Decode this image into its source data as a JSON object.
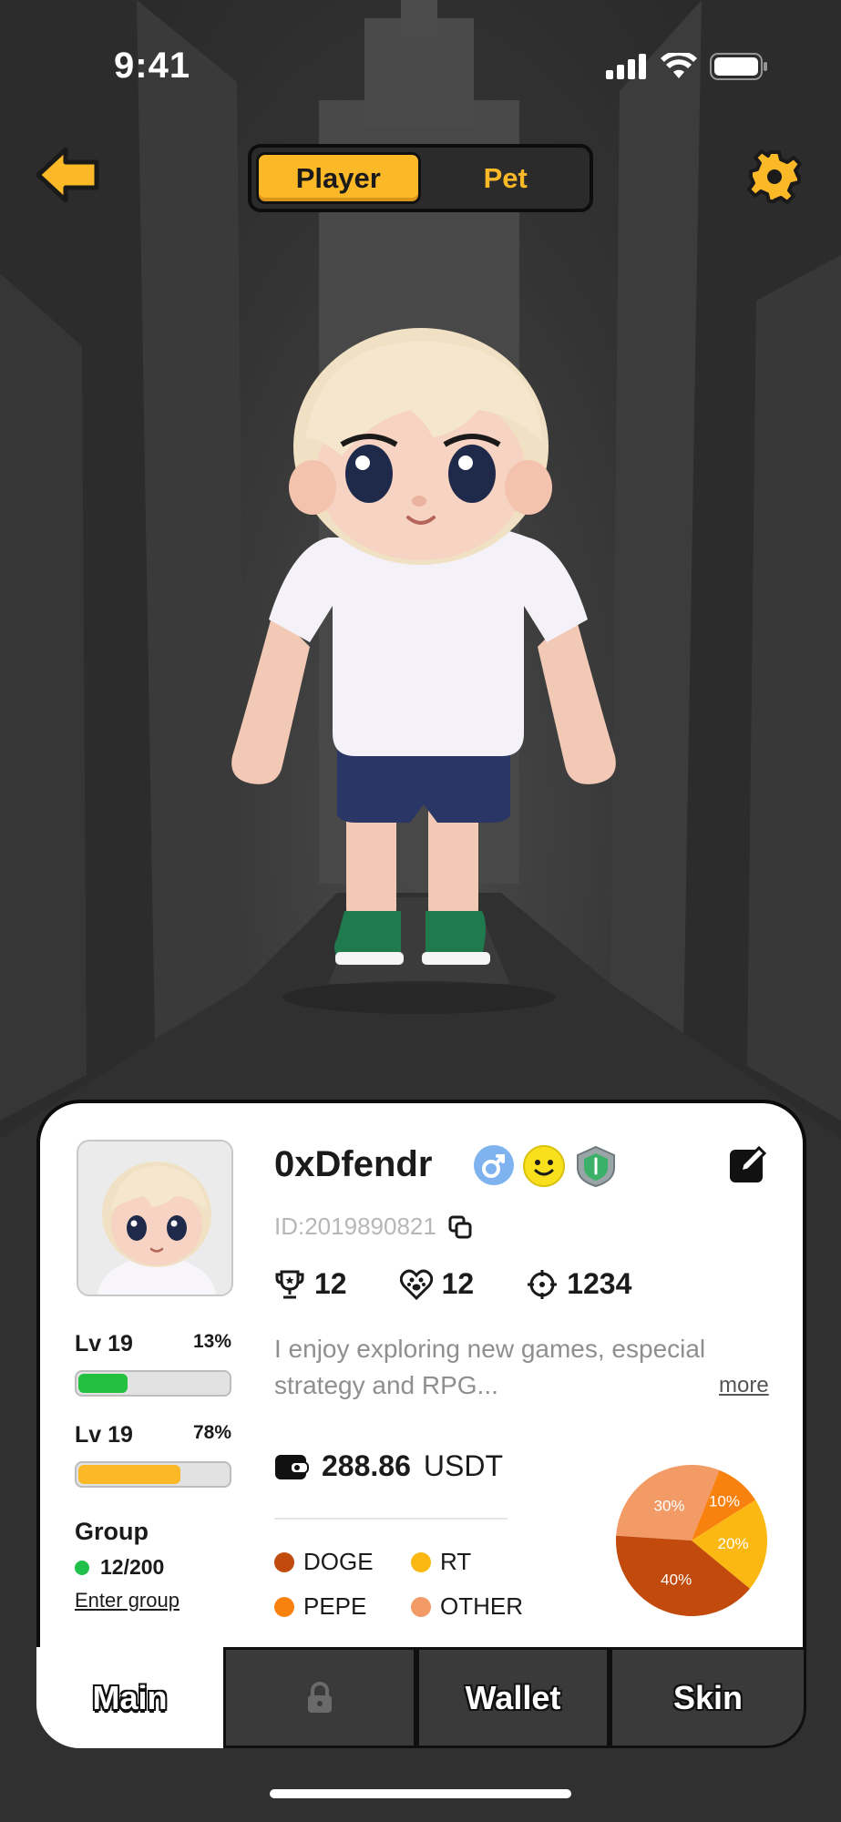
{
  "status_bar": {
    "time": "9:41"
  },
  "nav": {
    "segments": [
      {
        "label": "Player",
        "active": true
      },
      {
        "label": "Pet",
        "active": false
      }
    ]
  },
  "profile": {
    "username": "0xDfendr",
    "id": "ID:2019890821",
    "stats": {
      "trophies": "12",
      "pets": "12",
      "score": "1234"
    },
    "bio": "I enjoy exploring new games, especial strategy and RPG...",
    "more_label": "more",
    "levels": [
      {
        "label": "Lv 19",
        "percent_label": "13%",
        "progress": 0.33,
        "color": "#22c13f"
      },
      {
        "label": "Lv 19",
        "percent_label": "78%",
        "progress": 0.68,
        "color": "#fbb928"
      }
    ],
    "group": {
      "title": "Group",
      "count": "12/200",
      "enter_label": "Enter group"
    }
  },
  "wallet": {
    "amount": "288.86",
    "currency": "USDT",
    "legend": [
      {
        "name": "DOGE",
        "color": "#c14a0c"
      },
      {
        "name": "RT",
        "color": "#fbb812"
      },
      {
        "name": "PEPE",
        "color": "#f9820f"
      },
      {
        "name": "OTHER",
        "color": "#f29b67"
      }
    ],
    "chart_data": {
      "type": "pie",
      "slices": [
        {
          "label": "30%",
          "value": 30,
          "color": "#f29b67"
        },
        {
          "label": "10%",
          "value": 10,
          "color": "#f9820f"
        },
        {
          "label": "20%",
          "value": 20,
          "color": "#fbb812"
        },
        {
          "label": "40%",
          "value": 40,
          "color": "#c14a0c"
        }
      ]
    }
  },
  "tabs": [
    {
      "label": "Main",
      "active": true
    },
    {
      "label": "",
      "locked": true
    },
    {
      "label": "Wallet"
    },
    {
      "label": "Skin"
    }
  ]
}
